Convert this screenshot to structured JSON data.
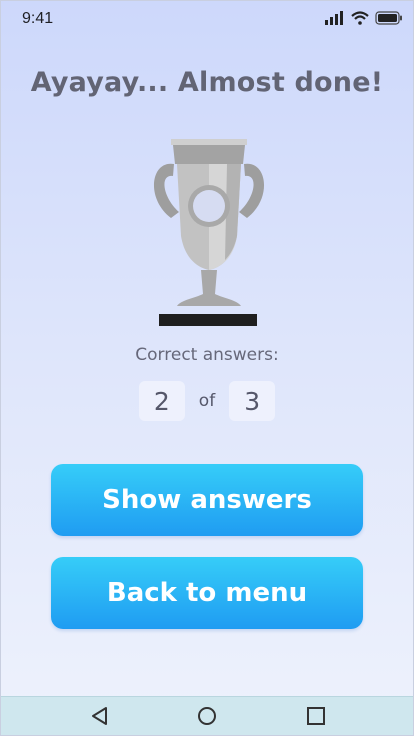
{
  "status_bar": {
    "time": "9:41",
    "icons": [
      "signal-icon",
      "wifi-icon",
      "battery-icon"
    ]
  },
  "result": {
    "headline": "Ayayay... Almost done!",
    "trophy_icon": "trophy-icon",
    "score_label": "Correct answers:",
    "correct": "2",
    "of_label": "of",
    "total": "3"
  },
  "actions": {
    "show_answers": "Show answers",
    "back_to_menu": "Back to menu"
  },
  "nav_bar": {
    "icons": [
      "back-triangle-icon",
      "home-circle-icon",
      "recents-square-icon"
    ]
  },
  "colors": {
    "button_top": "#36cdf8",
    "button_bottom": "#1f9cf2",
    "background": "#cdd8fb"
  }
}
